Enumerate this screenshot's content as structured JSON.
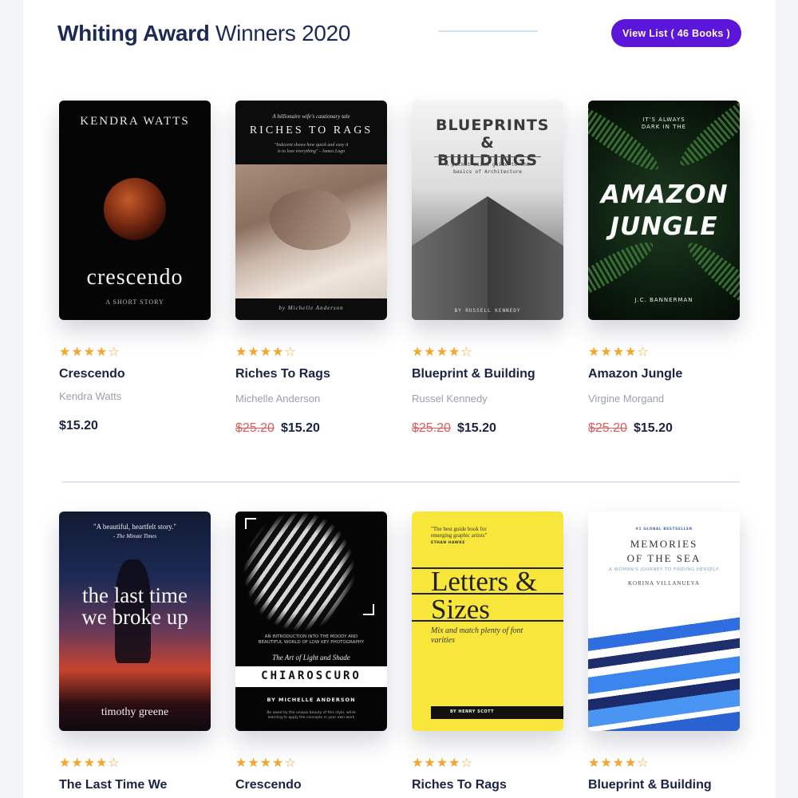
{
  "header": {
    "title_bold": "Whiting Award",
    "title_light": "Winners 2020",
    "view_button_label": "View List ( 46 Books )",
    "accent_color": "#5b16d9"
  },
  "rating_glyphs": "★★★★☆",
  "books": [
    {
      "title": "Crescendo",
      "author": "Kendra Watts",
      "old_price": "",
      "price": "$15.20",
      "rating": 4,
      "cover": {
        "author": "KENDRA WATTS",
        "title": "crescendo",
        "note": "A SHORT STORY"
      }
    },
    {
      "title": "Riches To Rags",
      "author": "Michelle Anderson",
      "old_price": "$25.20",
      "price": "$15.20",
      "rating": 4,
      "cover": {
        "tagline": "A billionaire wife's cautionary tale",
        "title": "RICHES TO RAGS",
        "quote": "\"Indecent shows how quick and easy it is to lose everything\" - James Lugo",
        "author": "by Michelle Anderson"
      }
    },
    {
      "title": "Blueprint & Building",
      "author": "Russel Kennedy",
      "old_price": "$25.20",
      "price": "$15.20",
      "rating": 4,
      "cover": {
        "title": "BLUEPRINTS & BUILDINGS",
        "subtitle": "A pocket-sized guide to the basics of Architecture",
        "author": "BY RUSSELL KENNEDY"
      }
    },
    {
      "title": "Amazon Jungle",
      "author": "Virgine Morgand",
      "old_price": "$25.20",
      "price": "$15.20",
      "rating": 4,
      "cover": {
        "pretitle": "IT'S ALWAYS DARK IN THE",
        "title": "AMAZON JUNGLE",
        "author": "J.C. BANNERMAN"
      }
    },
    {
      "title": "The Last Time We",
      "rating": 4,
      "cover": {
        "quote": "\"A beautiful, heartfelt story.\"",
        "quote_source": "- The Minute Times",
        "title": "the last time we broke up",
        "author": "timothy greene"
      }
    },
    {
      "title": "Crescendo",
      "rating": 4,
      "cover": {
        "intro": "AN INTRODUCTION INTO THE MOODY AND BEAUTIFUL WORLD OF LOW KEY PHOTOGRAPHY",
        "subtitle": "The Art of Light and Shade",
        "title": "CHIAROSCURO",
        "author": "BY MICHELLE ANDERSON",
        "note": "Be awed by the unique beauty of this style, while learning to apply the concepts in your own work"
      }
    },
    {
      "title": "Riches To Rags",
      "rating": 4,
      "cover": {
        "quote": "\"The best guide book for emerging graphic artists\"",
        "quote_source": "ETHAN HAWKE",
        "title": "Letters & Sizes",
        "subtitle": "Mix and match plenty of font varities",
        "author": "BY HENRY SCOTT"
      }
    },
    {
      "title": "Blueprint & Building",
      "rating": 4,
      "cover": {
        "pretitle": "#1 GLOBAL BESTSELLER",
        "title": "MEMORIES OF THE SEA",
        "subtitle": "A WOMAN'S JOURNEY TO FINDING HERSELF",
        "author": "KORINA VILLANUEVA"
      }
    }
  ]
}
